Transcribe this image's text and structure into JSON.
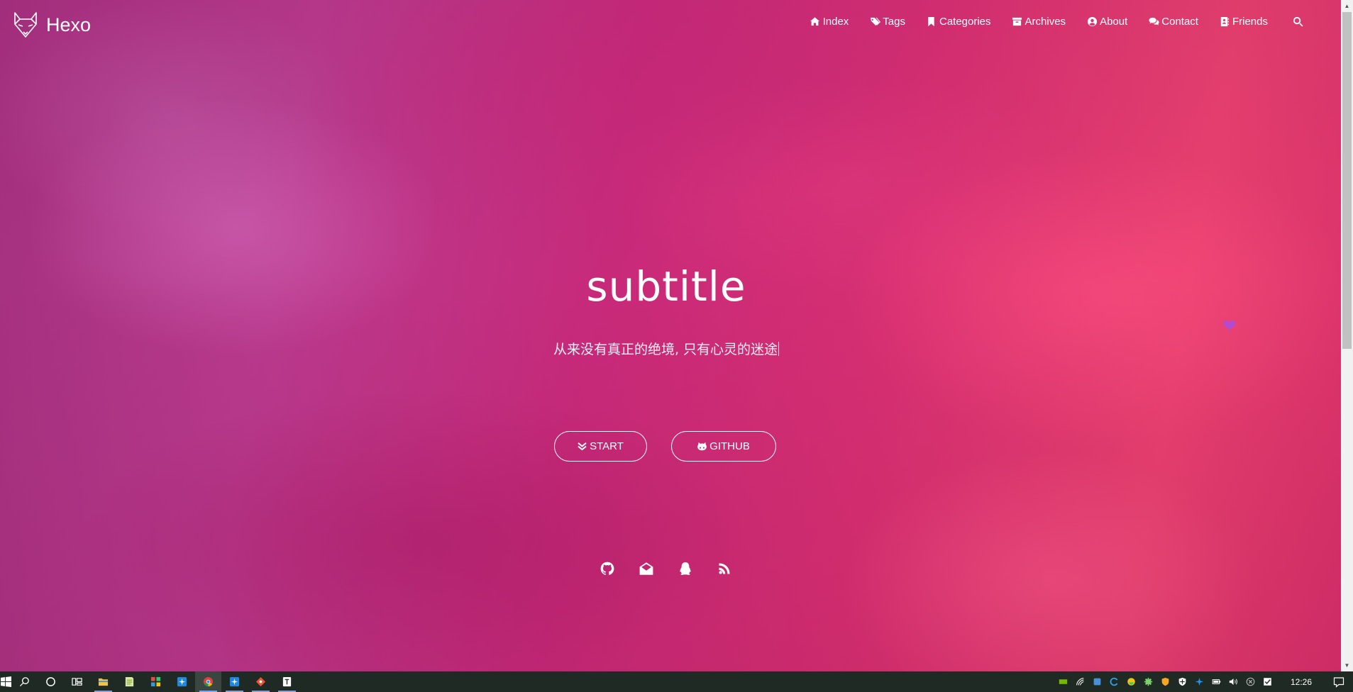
{
  "site": {
    "logo_text": "Hexo"
  },
  "nav": {
    "items": [
      {
        "label": "Index",
        "icon": "home-icon"
      },
      {
        "label": "Tags",
        "icon": "tags-icon"
      },
      {
        "label": "Categories",
        "icon": "bookmark-icon"
      },
      {
        "label": "Archives",
        "icon": "archive-icon"
      },
      {
        "label": "About",
        "icon": "user-circle-icon"
      },
      {
        "label": "Contact",
        "icon": "comments-icon"
      },
      {
        "label": "Friends",
        "icon": "address-book-icon"
      }
    ],
    "search_icon": "search-icon"
  },
  "hero": {
    "title": "subtitle",
    "subtitle": "从来没有真正的绝境, 只有心灵的迷途",
    "buttons": {
      "start_label": "START",
      "github_label": "GITHUB"
    },
    "social": [
      "github-icon",
      "envelope-open-icon",
      "qq-icon",
      "rss-icon"
    ]
  },
  "taskbar": {
    "clock": "12:26",
    "left_icons": [
      "windows-start-icon",
      "search-icon",
      "cortana-icon",
      "task-view-icon",
      "file-explorer-icon",
      "notepad-icon",
      "app-grid-icon",
      "snipaste-icon",
      "chrome-icon",
      "snipaste-icon",
      "git-icon",
      "typora-icon"
    ],
    "tray_icons": [
      "nvidia-icon",
      "network-icon",
      "app-icon",
      "edge-icon",
      "smile-icon",
      "gear-icon",
      "shield-icon",
      "defender-icon",
      "snipaste-icon",
      "battery-icon",
      "volume-icon",
      "close-circle-icon",
      "checkbox-icon"
    ]
  },
  "colors": {
    "accent": "#d72f72",
    "background_left": "#a4307f",
    "background_right": "#e8406f",
    "heart": "#b24bd2",
    "taskbar": "#1f2a24"
  }
}
